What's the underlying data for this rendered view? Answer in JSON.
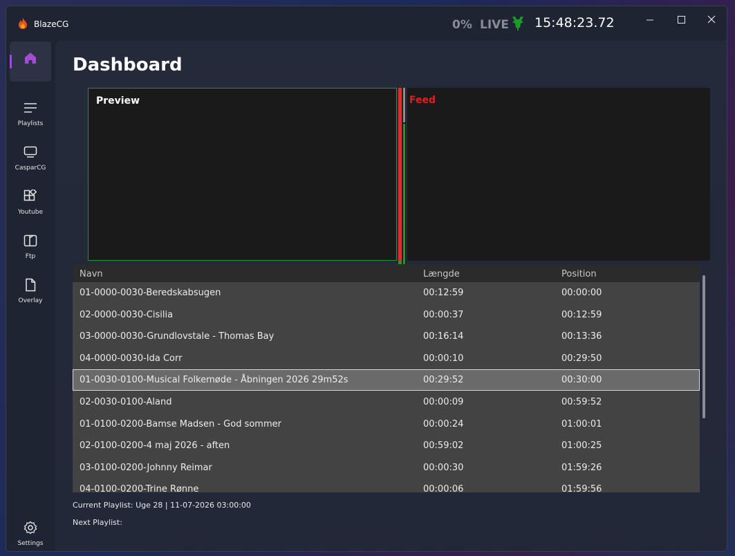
{
  "app": {
    "title": "BlazeCG"
  },
  "status": {
    "percent": "0%",
    "live": "LIVE",
    "clock": "15:48:23.72"
  },
  "sidebar": {
    "items": [
      {
        "label": "",
        "icon": "home-icon"
      },
      {
        "label": "Playlists",
        "icon": "list-icon"
      },
      {
        "label": "CasparCG",
        "icon": "monitor-icon"
      },
      {
        "label": "Youtube",
        "icon": "apps-icon"
      },
      {
        "label": "Ftp",
        "icon": "pages-icon"
      },
      {
        "label": "Overlay",
        "icon": "document-icon"
      }
    ],
    "settings": "Settings"
  },
  "page": {
    "title": "Dashboard"
  },
  "preview": {
    "label": "Preview"
  },
  "feed": {
    "label": "Feed"
  },
  "table": {
    "columns": [
      "Navn",
      "Længde",
      "Position"
    ],
    "rows": [
      [
        "01-0000-0030-Beredskabsugen",
        "00:12:59",
        "00:00:00"
      ],
      [
        "02-0000-0030-Cisilia",
        "00:00:37",
        "00:12:59"
      ],
      [
        "03-0000-0030-Grundlovstale - Thomas Bay",
        "00:16:14",
        "00:13:36"
      ],
      [
        "04-0000-0030-Ida Corr",
        "00:00:10",
        "00:29:50"
      ],
      [
        "01-0030-0100-Musical Folkemøde - Åbningen 2026 29m52s",
        "00:29:52",
        "00:30:00"
      ],
      [
        "02-0030-0100-Aland",
        "00:00:09",
        "00:59:52"
      ],
      [
        "01-0100-0200-Bamse Madsen - God sommer",
        "00:00:24",
        "01:00:01"
      ],
      [
        "02-0100-0200-4 maj 2026 - aften",
        "00:59:02",
        "01:00:25"
      ],
      [
        "03-0100-0200-Johnny Reimar",
        "00:00:30",
        "01:59:26"
      ],
      [
        "04-0100-0200-Trine Rønne",
        "00:00:06",
        "01:59:56"
      ]
    ]
  },
  "footer": {
    "current": "Current Playlist: Uge 28 | 11-07-2026 03:00:00",
    "next": "Next Playlist:"
  },
  "colors": {
    "accent": "#a24cd6",
    "live_green": "#1c9b2a",
    "feed_red": "#e41e1e"
  }
}
